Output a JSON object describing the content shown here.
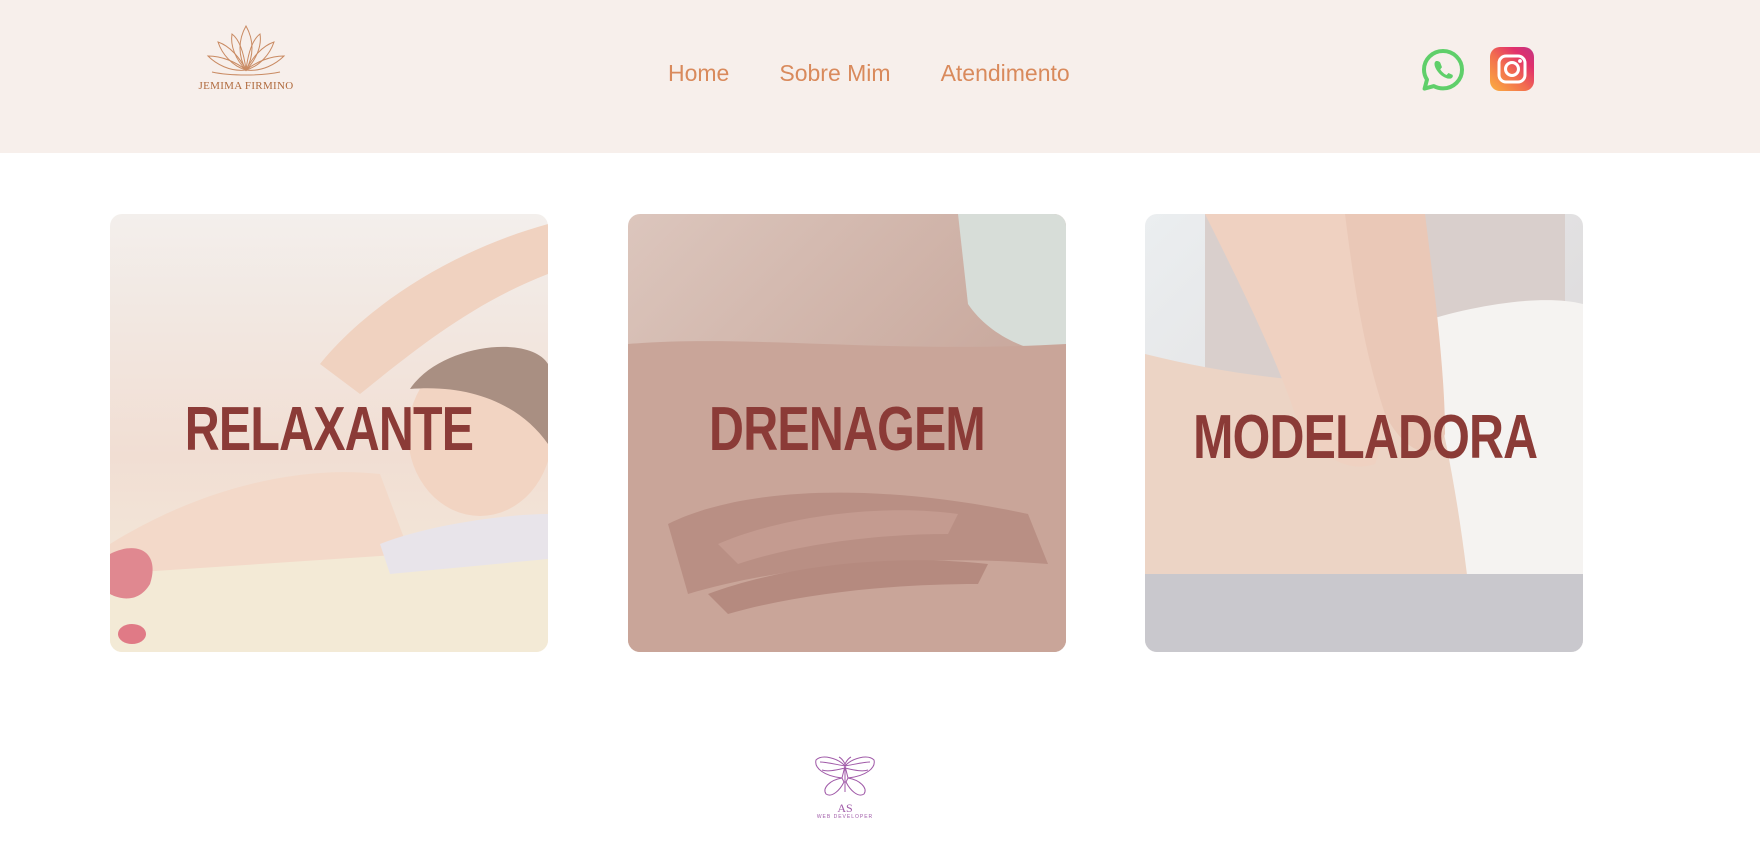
{
  "header": {
    "brand": "JEMIMA FIRMINO",
    "nav": [
      {
        "label": "Home"
      },
      {
        "label": "Sobre Mim"
      },
      {
        "label": "Atendimento"
      }
    ],
    "social": [
      {
        "icon": "whatsapp-icon",
        "color": "#5fcf6a"
      },
      {
        "icon": "instagram-icon",
        "color": "#e1306c"
      }
    ],
    "bg_color": "#f7efeb",
    "nav_color": "#d98a5c"
  },
  "services": [
    {
      "title": "RELAXANTE",
      "icon": "relaxing-massage-photo"
    },
    {
      "title": "DRENAGEM",
      "icon": "drainage-massage-photo"
    },
    {
      "title": "MODELADORA",
      "icon": "modeling-massage-photo"
    }
  ],
  "footer": {
    "logo_initials": "AS",
    "logo_tagline": "WEB DEVELOPER",
    "icon": "butterfly-icon",
    "color": "#a05aa8"
  },
  "colors": {
    "title": "#8b3b37"
  }
}
